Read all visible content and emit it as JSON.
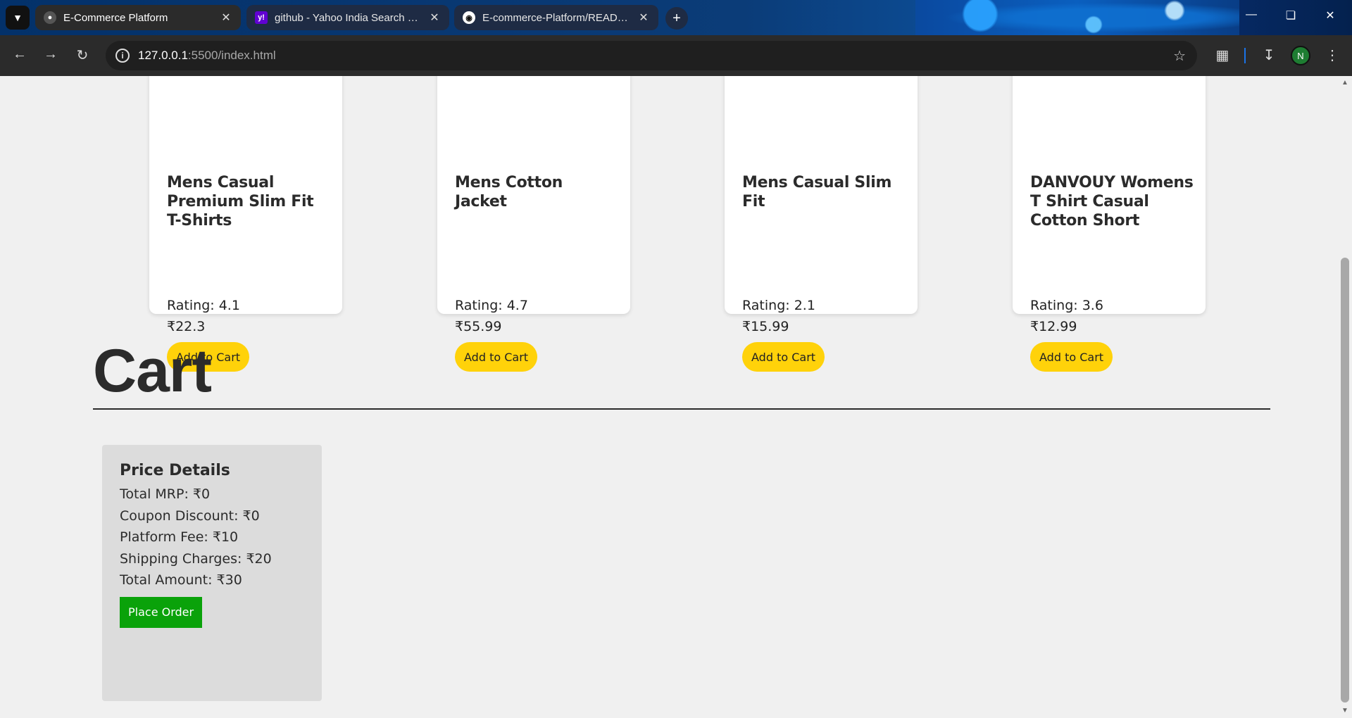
{
  "browser": {
    "tabs": [
      {
        "title": "E-Commerce Platform",
        "active": true
      },
      {
        "title": "github - Yahoo India Search Results",
        "active": false
      },
      {
        "title": "E-commerce-Platform/README.md",
        "active": false
      }
    ],
    "url_host": "127.0.0.1",
    "url_rest": ":5500/index.html",
    "profile_initial": "N"
  },
  "products": [
    {
      "name": "Mens Casual Premium Slim Fit T-Shirts",
      "rating": "Rating: 4.1",
      "price": "₹22.3",
      "button": "Add to Cart"
    },
    {
      "name": "Mens Cotton Jacket",
      "rating": "Rating: 4.7",
      "price": "₹55.99",
      "button": "Add to Cart"
    },
    {
      "name": "Mens Casual Slim Fit",
      "rating": "Rating: 2.1",
      "price": "₹15.99",
      "button": "Add to Cart"
    },
    {
      "name": "DANVOUY Womens T Shirt Casual Cotton Short",
      "rating": "Rating: 3.6",
      "price": "₹12.99",
      "button": "Add to Cart"
    }
  ],
  "cart": {
    "title": "Cart",
    "price_details": {
      "heading": "Price Details",
      "total_mrp": "Total MRP: ₹0",
      "coupon_discount": "Coupon Discount: ₹0",
      "platform_fee": "Platform Fee: ₹10",
      "shipping": "Shipping Charges: ₹20",
      "total_amount": "Total Amount: ₹30",
      "button": "Place Order"
    }
  },
  "colors": {
    "add_button": "#ffd20a",
    "place_order": "#0aa20a",
    "page_bg": "#f0f0f0"
  }
}
